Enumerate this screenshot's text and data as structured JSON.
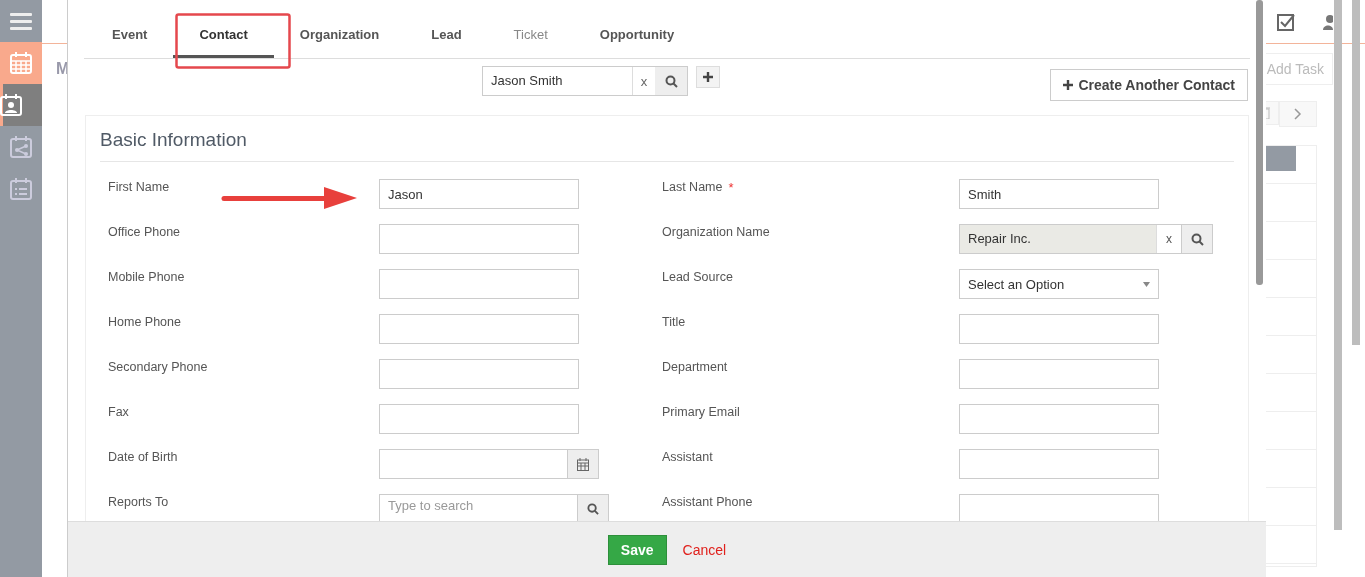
{
  "sidebar": {
    "items": [
      {
        "kind": "menu",
        "selected": false,
        "highlighted": false
      },
      {
        "kind": "calendar",
        "selected": false,
        "highlighted": true
      },
      {
        "kind": "contact",
        "selected": true,
        "highlighted": true
      },
      {
        "kind": "share",
        "selected": false,
        "highlighted": false
      },
      {
        "kind": "list",
        "selected": false,
        "highlighted": false
      }
    ]
  },
  "background": {
    "subheading": "M",
    "add_task": "Add Task"
  },
  "modal": {
    "tabs": [
      {
        "label": "Event",
        "selected": false,
        "disabled": false
      },
      {
        "label": "Contact",
        "selected": true,
        "disabled": false
      },
      {
        "label": "Organization",
        "selected": false,
        "disabled": false
      },
      {
        "label": "Lead",
        "selected": false,
        "disabled": false
      },
      {
        "label": "Ticket",
        "selected": false,
        "disabled": true
      },
      {
        "label": "Opportunity",
        "selected": false,
        "disabled": false
      }
    ],
    "search": {
      "value": "Jason Smith",
      "clear": "x"
    },
    "create_button": "Create Another Contact",
    "section_title": "Basic Information",
    "rows": [
      {
        "left": {
          "label": "First Name",
          "kind": "text",
          "value": "Jason"
        },
        "right": {
          "label": "Last Name",
          "kind": "text",
          "value": "Smith",
          "required_marker": "*"
        }
      },
      {
        "left": {
          "label": "Office Phone",
          "kind": "text"
        },
        "right": {
          "label": "Organization Name",
          "kind": "lookup",
          "value": "Repair Inc.",
          "clear": "x"
        }
      },
      {
        "left": {
          "label": "Mobile Phone",
          "kind": "text"
        },
        "right": {
          "label": "Lead Source",
          "kind": "select",
          "value": "Select an Option"
        }
      },
      {
        "left": {
          "label": "Home Phone",
          "kind": "text"
        },
        "right": {
          "label": "Title",
          "kind": "text"
        }
      },
      {
        "left": {
          "label": "Secondary Phone",
          "kind": "text"
        },
        "right": {
          "label": "Department",
          "kind": "text"
        }
      },
      {
        "left": {
          "label": "Fax",
          "kind": "text"
        },
        "right": {
          "label": "Primary Email",
          "kind": "text"
        }
      },
      {
        "left": {
          "label": "Date of Birth",
          "kind": "date"
        },
        "right": {
          "label": "Assistant",
          "kind": "text"
        }
      },
      {
        "left": {
          "label": "Reports To",
          "kind": "search",
          "placeholder": "Type to search"
        },
        "right": {
          "label": "Assistant Phone",
          "kind": "text"
        }
      }
    ],
    "footer": {
      "save": "Save",
      "cancel": "Cancel"
    }
  }
}
